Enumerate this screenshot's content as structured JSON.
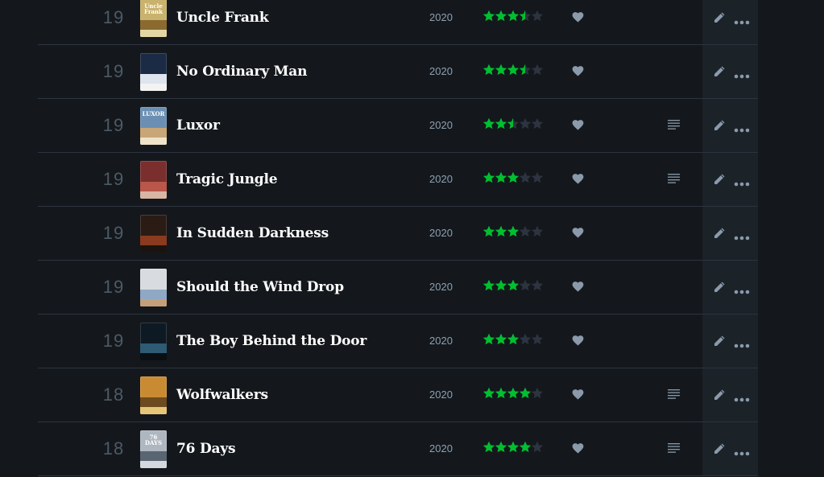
{
  "diary": {
    "entries": [
      {
        "day": "19",
        "title": "Uncle Frank",
        "year": "2020",
        "rating": 3.5,
        "liked": true,
        "has_review": false,
        "poster": {
          "text": "Uncle Frank",
          "colors": [
            "#c9b26b",
            "#8a6a2f",
            "#e3d6a4"
          ]
        }
      },
      {
        "day": "19",
        "title": "No Ordinary Man",
        "year": "2020",
        "rating": 3.5,
        "liked": true,
        "has_review": false,
        "poster": {
          "text": "",
          "colors": [
            "#1b2a45",
            "#dfe5ee",
            "#f3f3f3"
          ]
        }
      },
      {
        "day": "19",
        "title": "Luxor",
        "year": "2020",
        "rating": 2.5,
        "liked": true,
        "has_review": true,
        "poster": {
          "text": "LUXOR",
          "colors": [
            "#6b8fb3",
            "#c9a678",
            "#efe2c9"
          ]
        }
      },
      {
        "day": "19",
        "title": "Tragic Jungle",
        "year": "2020",
        "rating": 3,
        "liked": true,
        "has_review": true,
        "poster": {
          "text": "",
          "colors": [
            "#7a2f2e",
            "#b8574a",
            "#d9b5a4"
          ]
        }
      },
      {
        "day": "19",
        "title": "In Sudden Darkness",
        "year": "2020",
        "rating": 3,
        "liked": true,
        "has_review": false,
        "poster": {
          "text": "",
          "colors": [
            "#2a1b14",
            "#8a3a1e",
            "#1a1410"
          ]
        }
      },
      {
        "day": "19",
        "title": "Should the Wind Drop",
        "year": "2020",
        "rating": 3,
        "liked": true,
        "has_review": false,
        "poster": {
          "text": "",
          "colors": [
            "#d8dbe0",
            "#8fa8c4",
            "#c4a07a"
          ]
        }
      },
      {
        "day": "19",
        "title": "The Boy Behind the Door",
        "year": "2020",
        "rating": 3,
        "liked": true,
        "has_review": false,
        "poster": {
          "text": "",
          "colors": [
            "#0d1a24",
            "#2f5a73",
            "#0a0f14"
          ]
        }
      },
      {
        "day": "18",
        "title": "Wolfwalkers",
        "year": "2020",
        "rating": 4,
        "liked": true,
        "has_review": true,
        "poster": {
          "text": "",
          "colors": [
            "#c98b32",
            "#6e4a1f",
            "#e6c57a"
          ]
        }
      },
      {
        "day": "18",
        "title": "76 Days",
        "year": "2020",
        "rating": 4,
        "liked": true,
        "has_review": true,
        "poster": {
          "text": "76 DAYS",
          "colors": [
            "#aeb6c0",
            "#5a6573",
            "#d3d9df"
          ]
        }
      }
    ]
  },
  "colors": {
    "star_filled": "#00c030",
    "star_empty": "#2c3440",
    "heart": "#8a9aab",
    "icon": "#8a9aab"
  }
}
